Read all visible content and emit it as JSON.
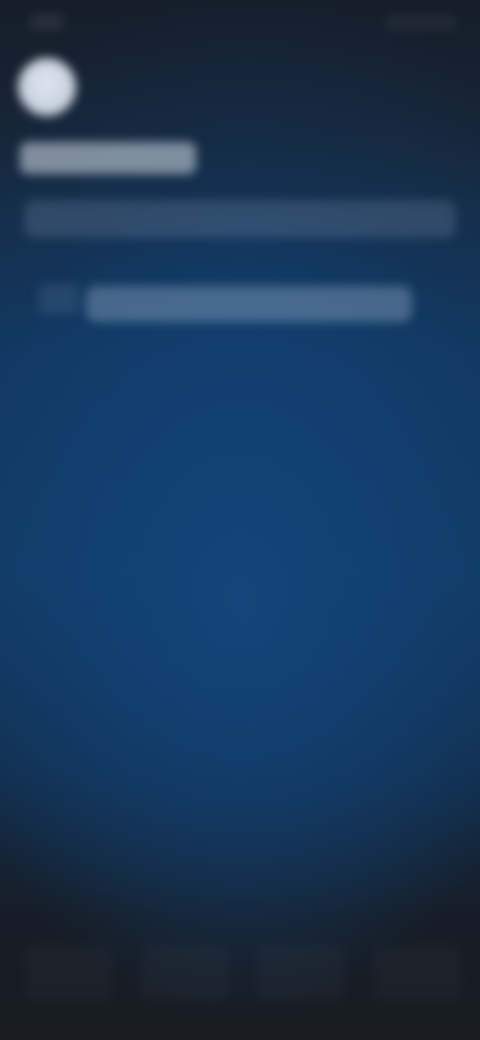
{
  "screen": {
    "colors": {
      "background_top": "#161d29",
      "background_center": "#123c66",
      "background_bottom": "#181c22",
      "icon_fill": "#dfe6ee"
    },
    "status_bar": {
      "icons": [
        "clock-icon",
        "battery-icon"
      ]
    },
    "header": {
      "icon": "app-icon"
    },
    "status_row": {
      "icon": "status-icon"
    },
    "bottom_bar": {
      "icons": [
        "bottom-action-icon"
      ]
    }
  }
}
